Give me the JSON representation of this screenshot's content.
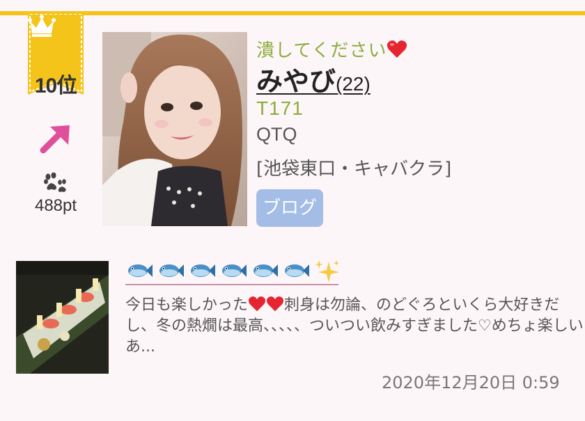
{
  "rank": {
    "label": "10位",
    "trend": "up-right-arrow-icon"
  },
  "points": "488pt",
  "profile": {
    "catchphrase": "潰してください",
    "name": "みやび",
    "age": "(22)",
    "height": "T171",
    "shop": "QTQ",
    "area": "[池袋東口・キャバクラ]",
    "blog_button": "ブログ"
  },
  "blog_entry": {
    "title_icons": [
      "fish-icon",
      "fish-icon",
      "fish-icon",
      "fish-icon",
      "fish-icon",
      "fish-icon",
      "sparkles-icon"
    ],
    "body_1": "今日も楽しかった",
    "body_2": "刺身は勿論、のどぐろといくら大好きだし、冬の熱燗は最高、、、、、ついつい飲みすぎました♡めちょ楽しいあ...",
    "date": "2020年12月20日 0:59"
  },
  "colors": {
    "accent_yellow": "#f5c41a",
    "accent_green": "#8dad3c",
    "button_blue": "#a3bde6",
    "arrow_pink": "#e0509a"
  }
}
